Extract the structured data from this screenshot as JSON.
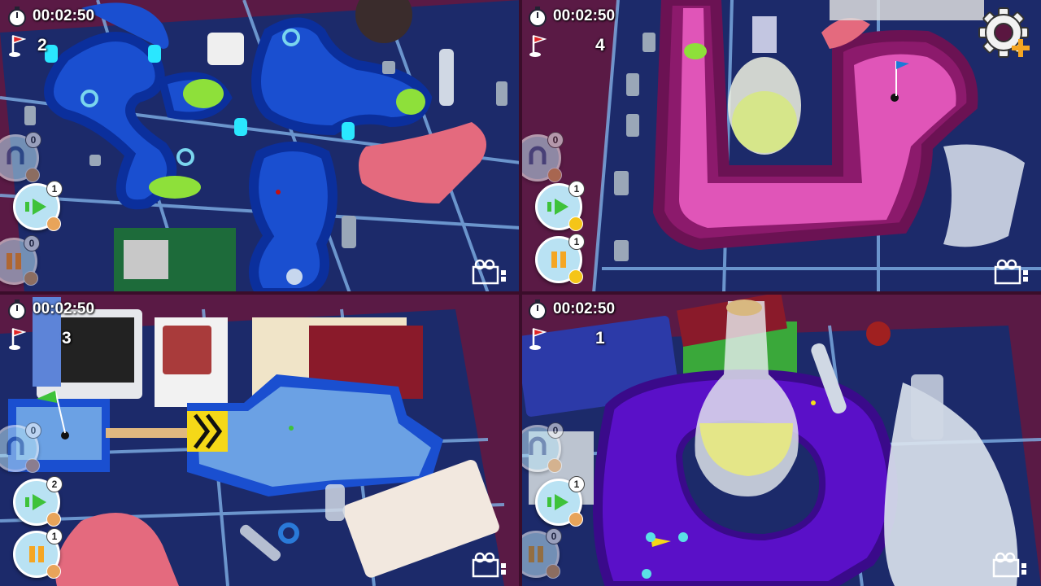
{
  "players": [
    {
      "timer": "00:02:50",
      "strokes": "2"
    },
    {
      "timer": "00:02:50",
      "strokes": "4"
    },
    {
      "timer": "00:02:50",
      "strokes": "3"
    },
    {
      "timer": "00:02:50",
      "strokes": "1"
    }
  ],
  "powerups": {
    "q0": [
      {
        "count": "0",
        "icon": "magnet-icon"
      },
      {
        "count": "1",
        "icon": "dash-arrow-icon"
      },
      {
        "count": "0",
        "icon": "pause-icon"
      }
    ],
    "q1": [
      {
        "count": "0",
        "icon": "magnet-icon"
      },
      {
        "count": "1",
        "icon": "dash-arrow-icon"
      },
      {
        "count": "1",
        "icon": "pause-icon"
      }
    ],
    "q2": [
      {
        "count": "0",
        "icon": "magnet-icon"
      },
      {
        "count": "2",
        "icon": "dash-arrow-icon"
      },
      {
        "count": "1",
        "icon": "pause-icon"
      }
    ],
    "q3": [
      {
        "count": "0",
        "icon": "magnet-icon"
      },
      {
        "count": "1",
        "icon": "dash-arrow-icon"
      },
      {
        "count": "0",
        "icon": "pause-icon"
      }
    ]
  },
  "icons": {
    "timer": "stopwatch-icon",
    "strokes": "golf-flag-icon",
    "camera": "camera-icon",
    "settings": "gear-plus-icon"
  },
  "colors": {
    "hud_text": "#ffffff",
    "button_bg": "#b9e2f3",
    "dash_arrow": "#3ec23a",
    "pause": "#f5a623",
    "settings_plus": "#f5a623"
  }
}
